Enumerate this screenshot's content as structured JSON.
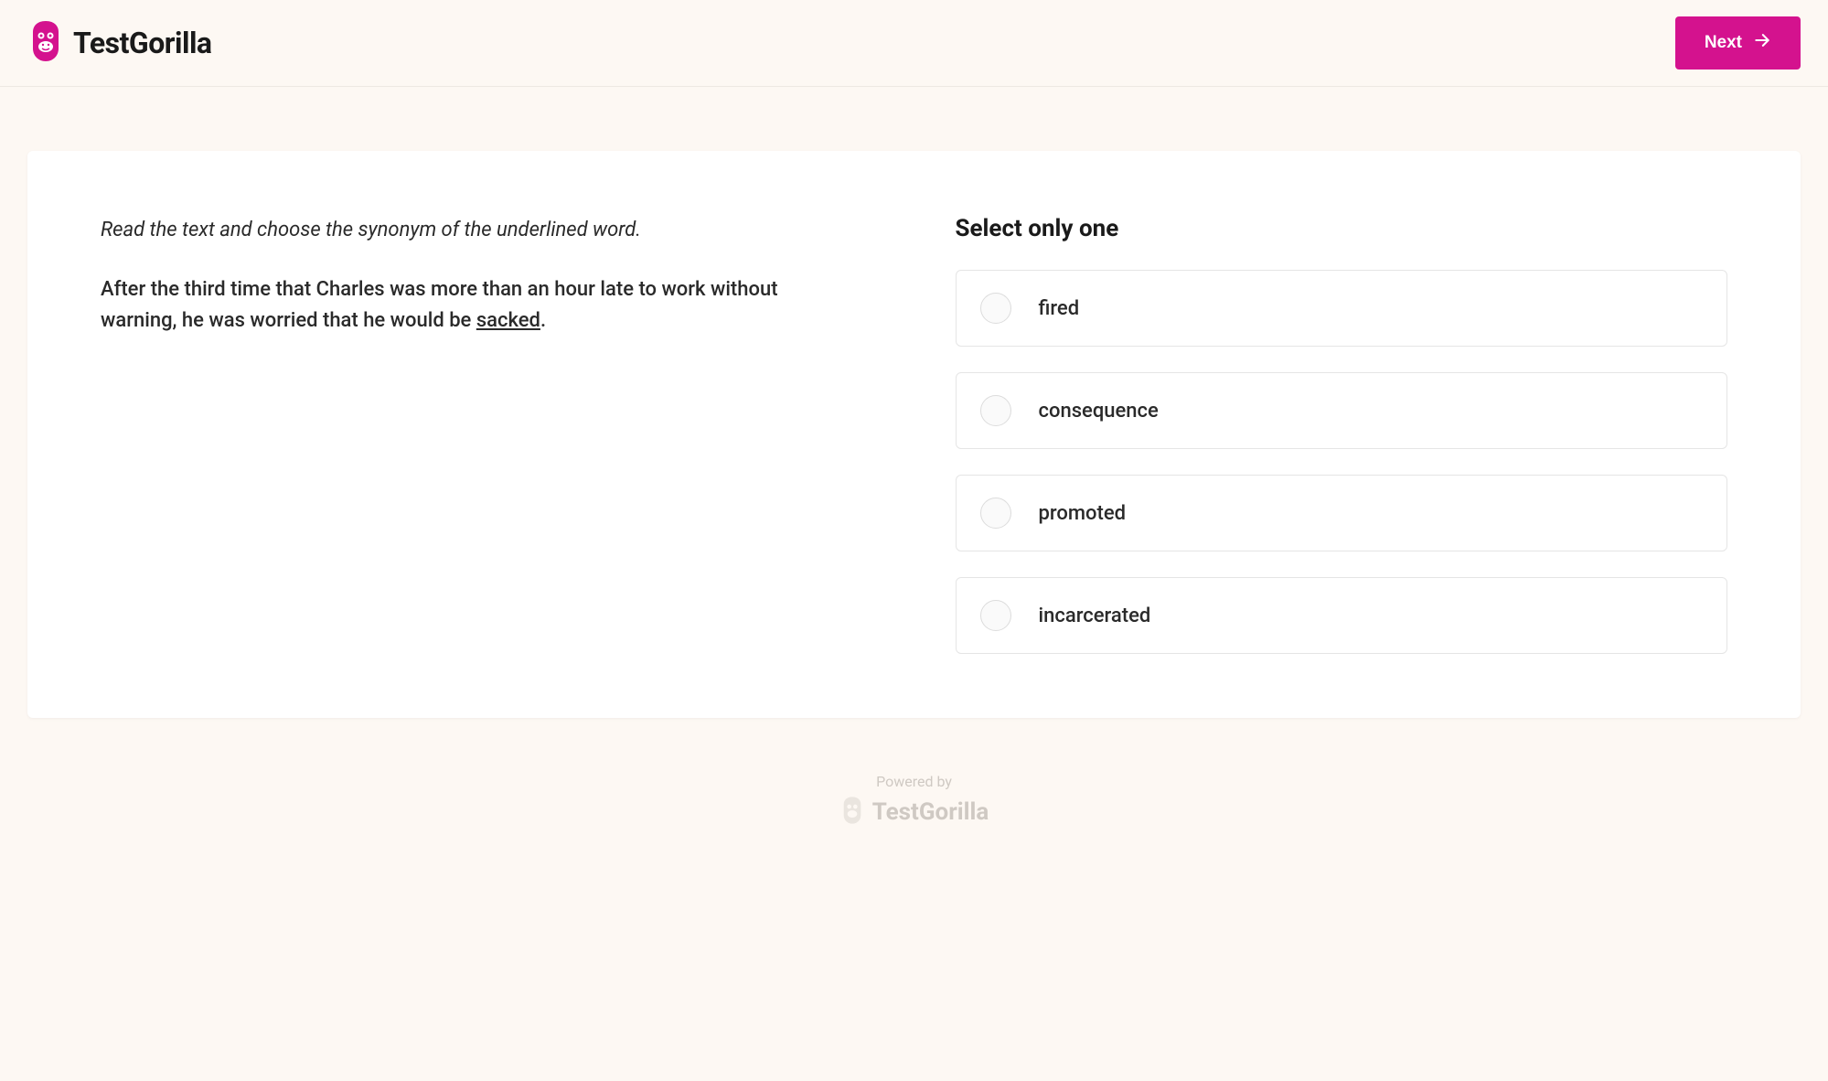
{
  "header": {
    "brand": "TestGorilla",
    "next_label": "Next"
  },
  "question": {
    "instruction": "Read the text and choose the synonym of the underlined word.",
    "passage_before": "After the third time that Charles was more than an hour late to work without warning, he was worried that he would be ",
    "underlined_word": "sacked",
    "passage_after": "."
  },
  "answers": {
    "title": "Select only one",
    "options": [
      {
        "label": "fired"
      },
      {
        "label": "consequence"
      },
      {
        "label": "promoted"
      },
      {
        "label": "incarcerated"
      }
    ]
  },
  "footer": {
    "powered_by": "Powered by",
    "brand": "TestGorilla"
  }
}
